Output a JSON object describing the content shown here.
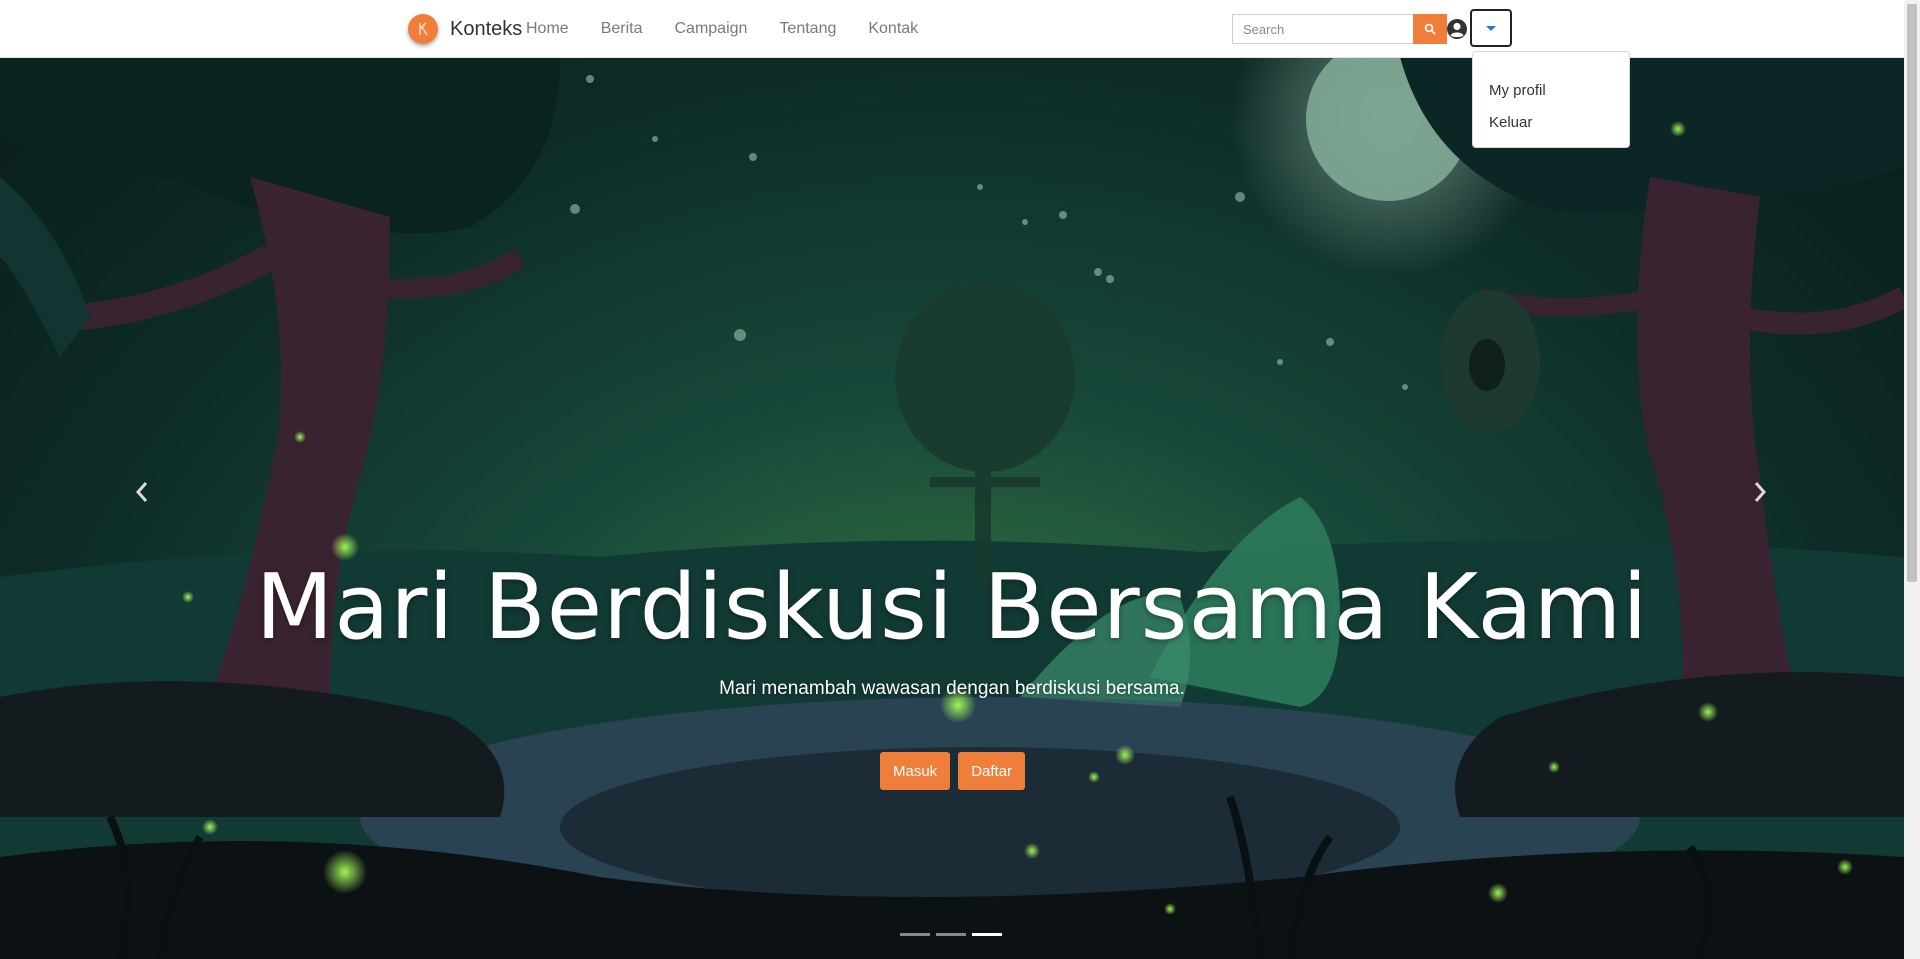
{
  "brand": {
    "name": "Konteks"
  },
  "nav": {
    "links": [
      "Home",
      "Berita",
      "Campaign",
      "Tentang",
      "Kontak"
    ]
  },
  "search": {
    "placeholder": "Search"
  },
  "user_menu": {
    "items": [
      "My profil",
      "Keluar"
    ]
  },
  "hero": {
    "title": "Mari Berdiskusi Bersama Kami",
    "subtitle": "Mari menambah wawasan dengan berdiskusi bersama.",
    "login_label": "Masuk",
    "register_label": "Daftar",
    "active_slide": 3,
    "slide_count": 3
  },
  "colors": {
    "accent": "#f07e3b",
    "navbar_bg": "#ffffff",
    "hero_dark": "#0e2c27"
  },
  "icons": [
    "brand-logo-icon",
    "search-icon",
    "user-circle-icon",
    "caret-down-icon",
    "chevron-left-icon",
    "chevron-right-icon"
  ]
}
